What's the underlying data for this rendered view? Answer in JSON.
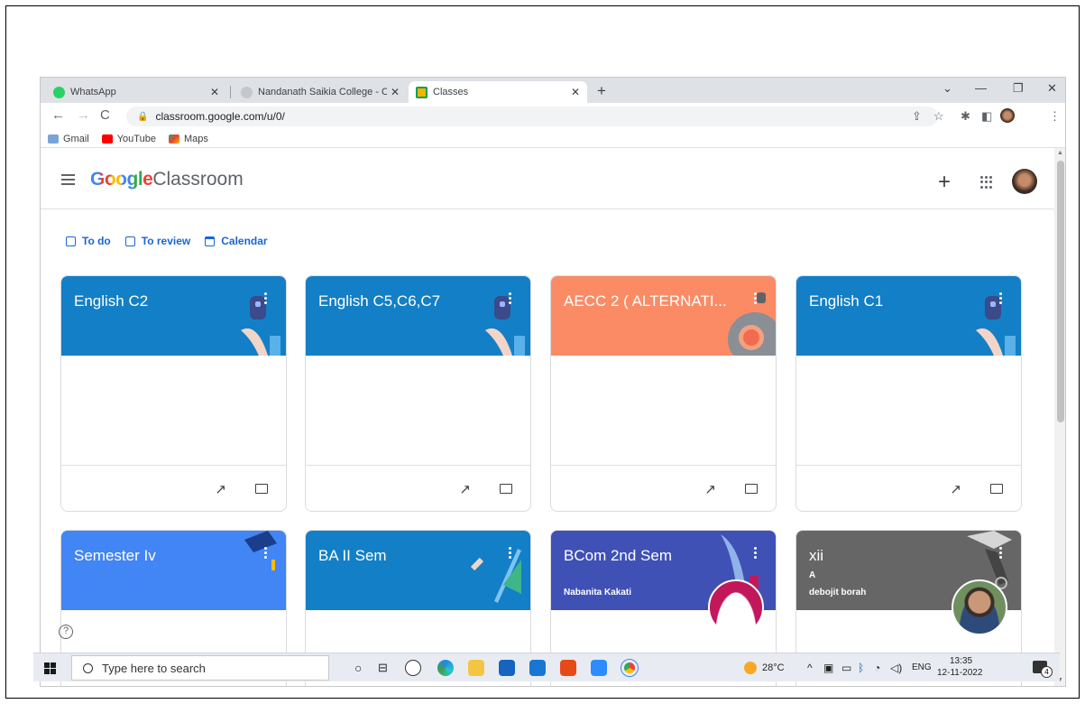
{
  "browser": {
    "tabs": [
      {
        "title": "WhatsApp",
        "active": false,
        "icon": "whatsapp-icon"
      },
      {
        "title": "Nandanath Saikia College - Orga",
        "active": false,
        "icon": "college-icon"
      },
      {
        "title": "Classes",
        "active": true,
        "icon": "classroom-icon"
      }
    ],
    "url": "classroom.google.com/u/0/",
    "bookmarks": [
      "Gmail",
      "YouTube",
      "Maps"
    ]
  },
  "header": {
    "brand_google": "Google",
    "brand_product": "Classroom"
  },
  "subnav": [
    "To do",
    "To review",
    "Calendar"
  ],
  "cards": [
    {
      "title": "English C2",
      "section": "",
      "owner": "",
      "color": "#137fc6"
    },
    {
      "title": "English C5,C6,C7",
      "section": "",
      "owner": "",
      "color": "#137fc6"
    },
    {
      "title": "AECC 2 ( ALTERNATI...",
      "section": "",
      "owner": "",
      "color": "#fa8b64"
    },
    {
      "title": "English C1",
      "section": "",
      "owner": "",
      "color": "#137fc6"
    },
    {
      "title": "Semester Iv",
      "section": "",
      "owner": "",
      "color": "#4285f4"
    },
    {
      "title": "BA II Sem",
      "section": "",
      "owner": "",
      "color": "#137fc6"
    },
    {
      "title": "BCom 2nd Sem",
      "section": "",
      "owner": "Nabanita Kakati",
      "color": "#3f51b5"
    },
    {
      "title": "xii",
      "section": "A",
      "owner": "debojit borah",
      "color": "#666666"
    }
  ],
  "taskbar": {
    "search_placeholder": "Type here to search",
    "weather": "28°C",
    "lang": "ENG",
    "time": "13:35",
    "date": "12-11-2022",
    "notifications": "4"
  }
}
